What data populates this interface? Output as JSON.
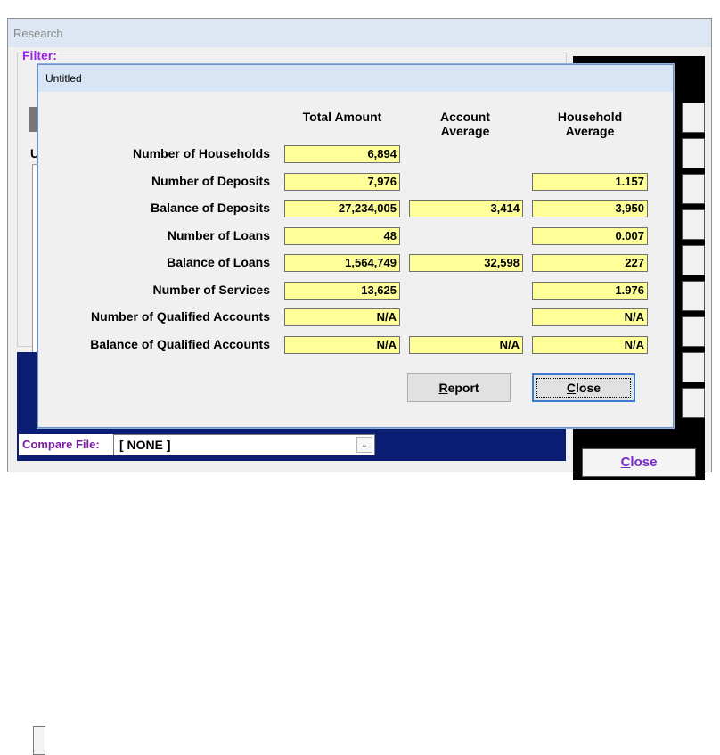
{
  "background_window": {
    "title": "Research",
    "filter_label": "Filter:",
    "u_label": "U",
    "compare_file_label": "Compare File:",
    "compare_file_value": "[ NONE ]",
    "menu_header": "",
    "close_prefix": "",
    "close_underlined": "C",
    "close_rest": "lose"
  },
  "dialog": {
    "title": "Untitled",
    "columns": [
      "Total Amount",
      "Account\nAverage",
      "Household\nAverage"
    ],
    "rows": [
      {
        "label": "Number of Households",
        "total": "6,894",
        "account_avg": null,
        "household_avg": null
      },
      {
        "label": "Number of Deposits",
        "total": "7,976",
        "account_avg": null,
        "household_avg": "1.157"
      },
      {
        "label": "Balance of Deposits",
        "total": "27,234,005",
        "account_avg": "3,414",
        "household_avg": "3,950"
      },
      {
        "label": "Number of Loans",
        "total": "48",
        "account_avg": null,
        "household_avg": "0.007"
      },
      {
        "label": "Balance of Loans",
        "total": "1,564,749",
        "account_avg": "32,598",
        "household_avg": "227"
      },
      {
        "label": "Number of Services",
        "total": "13,625",
        "account_avg": null,
        "household_avg": "1.976"
      },
      {
        "label": "Number of Qualified Accounts",
        "total": "N/A",
        "account_avg": null,
        "household_avg": "N/A"
      },
      {
        "label": "Balance of Qualified Accounts",
        "total": "N/A",
        "account_avg": "N/A",
        "household_avg": "N/A"
      }
    ],
    "report_button": {
      "underlined": "R",
      "rest": "eport"
    },
    "close_button": {
      "underlined": "C",
      "rest": "lose"
    }
  },
  "colors": {
    "cell_fill": "#ffff99",
    "navy": "#0b1d73",
    "filter_purple": "#9a25e8",
    "titlebar": "#d7e5f5"
  }
}
